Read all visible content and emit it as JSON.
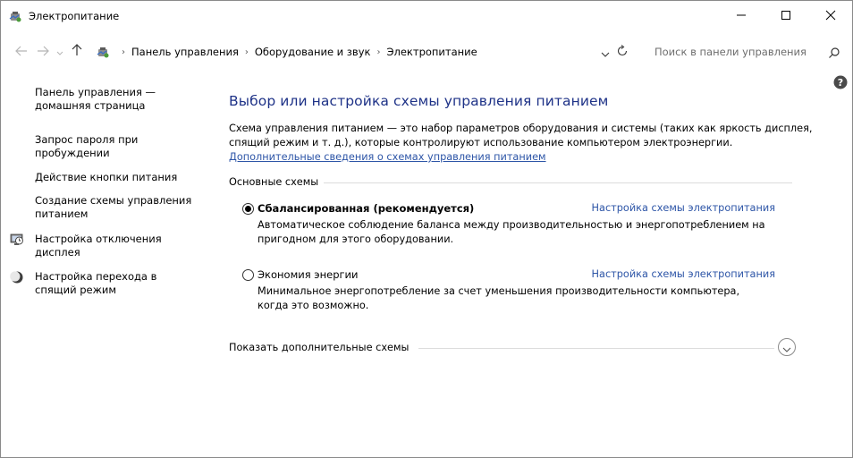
{
  "window": {
    "title": "Электропитание",
    "app_icon": "power-options-icon"
  },
  "controls": {
    "minimize_icon": "minimize-icon",
    "maximize_icon": "maximize-icon",
    "close_icon": "close-icon"
  },
  "address": {
    "breadcrumbs": [
      "Панель управления",
      "Оборудование и звук",
      "Электропитание"
    ]
  },
  "search": {
    "placeholder": "Поиск в панели управления"
  },
  "sidebar": {
    "items": [
      {
        "label": "Панель управления —\nдомашняя страница",
        "icon": ""
      },
      {
        "label": "Запрос пароля при\nпробуждении",
        "icon": ""
      },
      {
        "label": "Действие кнопки питания",
        "icon": ""
      },
      {
        "label": "Создание схемы управления\nпитанием",
        "icon": ""
      },
      {
        "label": "Настройка отключения\nдисплея",
        "icon": "display-off-icon"
      },
      {
        "label": "Настройка перехода в\nспящий режим",
        "icon": "sleep-moon-icon"
      }
    ]
  },
  "main": {
    "title": "Выбор или настройка схемы управления питанием",
    "description": "Схема управления питанием — это набор параметров оборудования и системы (таких как яркость дисплея, спящий режим и т. д.), которые контролируют использование компьютером электроэнергии.",
    "more_info_link": "Дополнительные сведения о схемах управления питанием",
    "group_label": "Основные схемы",
    "plans": [
      {
        "name": "Сбалансированная (рекомендуется)",
        "selected": true,
        "settings_link": "Настройка схемы электропитания",
        "description": "Автоматическое соблюдение баланса между производительностью и энергопотреблением на пригодном для этого оборудовании."
      },
      {
        "name": "Экономия энергии",
        "selected": false,
        "settings_link": "Настройка схемы электропитания",
        "description": "Минимальное энергопотребление за счет уменьшения производительности компьютера, когда это возможно."
      }
    ],
    "show_more_label": "Показать дополнительные схемы"
  },
  "colors": {
    "title_blue": "#1e3287",
    "link_blue": "#2d55a7"
  }
}
